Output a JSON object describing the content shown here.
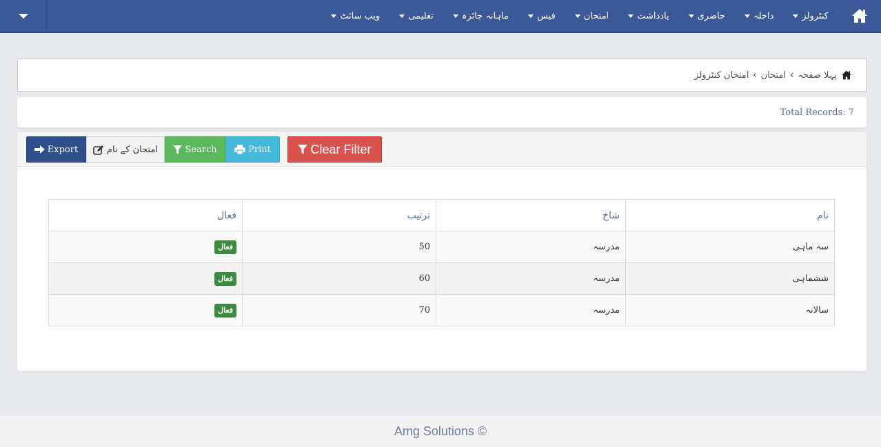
{
  "navbar": {
    "toggle_icon": "caret-down-icon",
    "home_icon": "home-icon",
    "items": [
      {
        "label": "کنٹرولز"
      },
      {
        "label": "داخلہ"
      },
      {
        "label": "حاضری"
      },
      {
        "label": "یادداشت"
      },
      {
        "label": "امتحان"
      },
      {
        "label": "فیس"
      },
      {
        "label": "ماہانہ جائزہ"
      },
      {
        "label": "تعلیمی"
      },
      {
        "label": "ویب سائٹ"
      }
    ]
  },
  "breadcrumb": {
    "home_icon": "home-icon",
    "items": [
      {
        "label": "پہلا صفحہ"
      },
      {
        "label": "امتحان"
      },
      {
        "label": "امتحان کنٹرولز"
      }
    ],
    "separator": "›"
  },
  "records": {
    "total_label": "Total Records: 7"
  },
  "toolbar": {
    "export_label": "Export",
    "exam_names_label": "امتحان کے نام",
    "search_label": "Search",
    "print_label": "Print",
    "clear_filter_label": "Clear Filter"
  },
  "table": {
    "headers": [
      "نام",
      "شاخ",
      "ترتیب",
      "فعال"
    ],
    "rows": [
      {
        "name": "سہ ماہی",
        "branch": "مدرسہ",
        "order": "50",
        "active": "فعال"
      },
      {
        "name": "ششماہی",
        "branch": "مدرسہ",
        "order": "60",
        "active": "فعال"
      },
      {
        "name": "سالانہ",
        "branch": "مدرسہ",
        "order": "70",
        "active": "فعال"
      }
    ]
  },
  "colors": {
    "navbar": "#3b5998",
    "export": "#2f4f8a",
    "search": "#5cb85c",
    "print": "#46b8da",
    "clear_filter": "#d9534f",
    "active_badge": "#3d8b40"
  },
  "footer": {
    "text": "Amg Solutions ©"
  }
}
